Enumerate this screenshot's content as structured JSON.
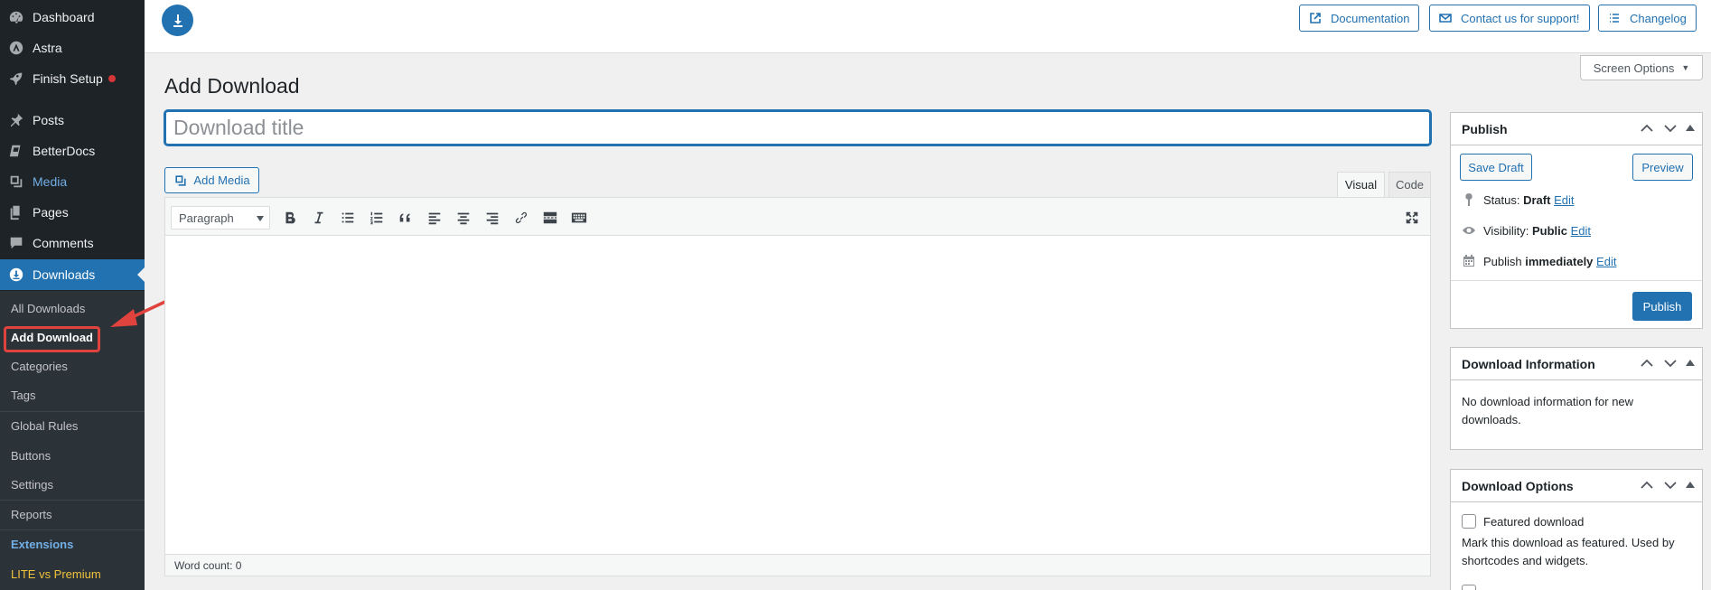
{
  "sidebar": {
    "items": [
      {
        "label": "Dashboard",
        "icon": "dashboard-icon"
      },
      {
        "label": "Astra",
        "icon": "astra-icon"
      },
      {
        "label": "Finish Setup",
        "icon": "rocket-icon"
      },
      {
        "label": "Posts",
        "icon": "pin-icon"
      },
      {
        "label": "BetterDocs",
        "icon": "docs-icon"
      },
      {
        "label": "Media",
        "icon": "media-icon"
      },
      {
        "label": "Pages",
        "icon": "pages-icon"
      },
      {
        "label": "Comments",
        "icon": "comments-icon"
      },
      {
        "label": "Downloads",
        "icon": "download-icon"
      }
    ],
    "submenu": [
      "All Downloads",
      "Add Download",
      "Categories",
      "Tags",
      "Global Rules",
      "Buttons",
      "Settings",
      "Reports",
      "Extensions",
      "LITE vs Premium"
    ]
  },
  "topbar": {
    "documentation": "Documentation",
    "contact": "Contact us for support!",
    "changelog": "Changelog"
  },
  "main": {
    "screen_options": "Screen Options",
    "page_title": "Add Download",
    "title_placeholder": "Download title",
    "add_media": "Add Media",
    "tab_visual": "Visual",
    "tab_code": "Code",
    "format": "Paragraph",
    "word_count": "Word count: 0"
  },
  "publish": {
    "title": "Publish",
    "save_draft": "Save Draft",
    "preview": "Preview",
    "status_label": "Status:",
    "status_value": "Draft",
    "visibility_label": "Visibility:",
    "visibility_value": "Public",
    "publish_label": "Publish",
    "publish_value": "immediately",
    "edit": "Edit",
    "publish_button": "Publish"
  },
  "download_information": {
    "title": "Download Information",
    "text": "No download information for new downloads."
  },
  "download_options": {
    "title": "Download Options",
    "featured_label": "Featured download",
    "featured_desc": "Mark this download as featured. Used by shortcodes and widgets."
  },
  "colors": {
    "accent": "#2271b1",
    "sidebar": "#1d2327",
    "highlight": "#e0433e"
  }
}
